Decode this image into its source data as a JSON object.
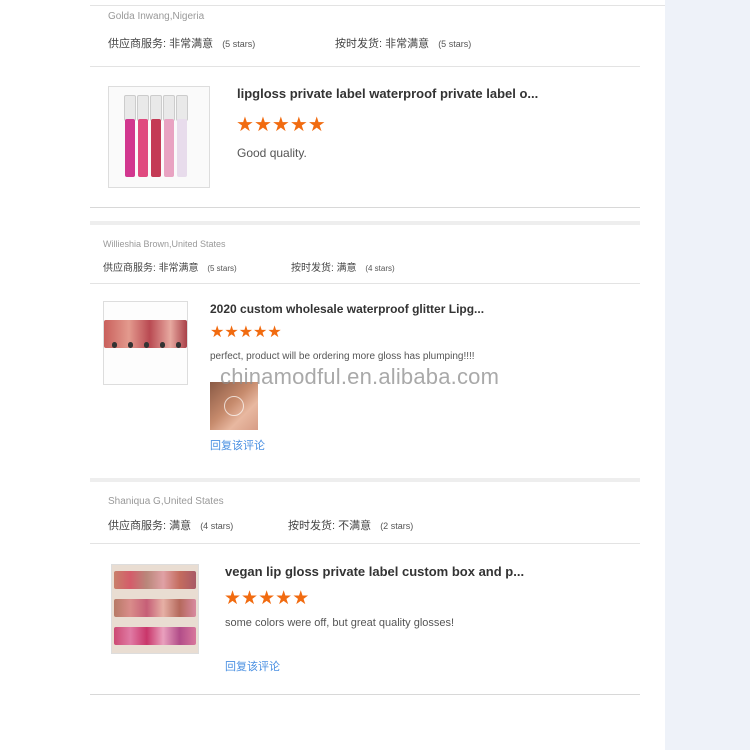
{
  "colors": {
    "star": "#f16b10",
    "link": "#4a90e2",
    "side_panel": "#eef2f9"
  },
  "reviews": [
    {
      "name": "Golda Inwang,Nigeria",
      "supplier_label": "供应商服务:",
      "supplier_value": "非常满意",
      "supplier_stars": "(5 stars)",
      "ship_label": "按时发货:",
      "ship_value": "非常满意",
      "ship_stars": "(5 stars)",
      "product_title": "lipgloss private label waterproof private label o...",
      "rating": 5,
      "comment": "Good quality."
    },
    {
      "name": "Willieshia Brown,United States",
      "supplier_label": "供应商服务:",
      "supplier_value": "非常满意",
      "supplier_stars": "(5 stars)",
      "ship_label": "按时发货:",
      "ship_value": "满意",
      "ship_stars": "(4 stars)",
      "product_title": "2020 custom wholesale waterproof glitter Lipg...",
      "rating": 5,
      "comment": "perfect, product will be ordering more gloss has plumping!!!!",
      "reply": "回复该评论"
    },
    {
      "name": "Shaniqua G,United States",
      "supplier_label": "供应商服务:",
      "supplier_value": "满意",
      "supplier_stars": "(4 stars)",
      "ship_label": "按时发货:",
      "ship_value": "不满意",
      "ship_stars": "(2 stars)",
      "product_title": "vegan lip gloss private label custom box and p...",
      "rating": 5,
      "comment": "some colors were off, but great quality glosses!",
      "reply": "回复该评论"
    }
  ],
  "watermark": "chinamodful.en.alibaba.com"
}
